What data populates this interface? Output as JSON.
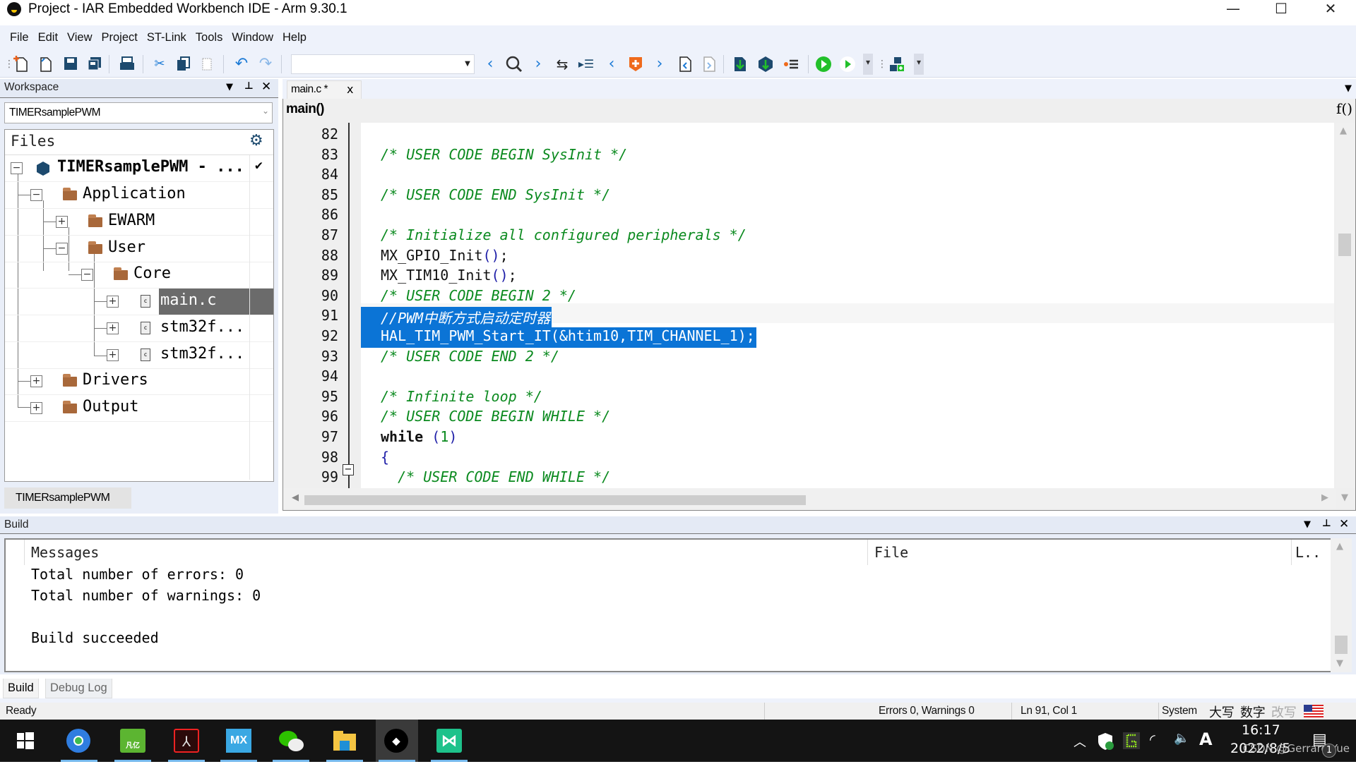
{
  "window": {
    "title": "Project - IAR Embedded Workbench IDE - Arm 9.30.1",
    "controls": {
      "minimize": "—",
      "maximize": "☐",
      "close": "✕"
    }
  },
  "menu": [
    "File",
    "Edit",
    "View",
    "Project",
    "ST-Link",
    "Tools",
    "Window",
    "Help"
  ],
  "toolbar": {
    "icons": [
      "new-file",
      "open-file",
      "save",
      "save-all",
      "print",
      "cut",
      "copy",
      "paste",
      "undo",
      "redo",
      "find-combo",
      "navigate-back",
      "find",
      "navigate-forward",
      "toggle-bookmark",
      "indent",
      "previous-bookmark",
      "toggle-breakpoint",
      "next-bookmark",
      "previous-error",
      "next-error",
      "download-debug",
      "debug-without-download",
      "stop-build",
      "make-run",
      "run-without-debug",
      "configure"
    ],
    "search_value": ""
  },
  "workspace": {
    "title": "Workspace",
    "config": "TIMERsamplePWM",
    "files_header": "Files",
    "tree": [
      {
        "label": "TIMERsamplePWM - ...",
        "type": "project",
        "expanded": true,
        "checked": true
      },
      {
        "label": "Application",
        "type": "folder",
        "expanded": true
      },
      {
        "label": "EWARM",
        "type": "folder",
        "expanded": false
      },
      {
        "label": "User",
        "type": "folder",
        "expanded": true
      },
      {
        "label": "Core",
        "type": "folder",
        "expanded": true
      },
      {
        "label": "main.c",
        "type": "file",
        "selected": true
      },
      {
        "label": "stm32f...",
        "type": "file"
      },
      {
        "label": "stm32f...",
        "type": "file"
      },
      {
        "label": "Drivers",
        "type": "folder",
        "expanded": false
      },
      {
        "label": "Output",
        "type": "folder",
        "expanded": false
      }
    ],
    "bottom_tab": "TIMERsamplePWM"
  },
  "editor": {
    "tab": "main.c *",
    "tab_close": "x",
    "function_scope": "main()",
    "function_icon": "f()",
    "lines": [
      {
        "n": "82",
        "text": ""
      },
      {
        "n": "83",
        "text": "/* USER CODE BEGIN SysInit */"
      },
      {
        "n": "84",
        "text": ""
      },
      {
        "n": "85",
        "text": "/* USER CODE END SysInit */"
      },
      {
        "n": "86",
        "text": ""
      },
      {
        "n": "87",
        "text": "/* Initialize all configured peripherals */"
      },
      {
        "n": "88",
        "text": "MX_GPIO_Init();"
      },
      {
        "n": "89",
        "text": "MX_TIM10_Init();"
      },
      {
        "n": "90",
        "text": "/* USER CODE BEGIN 2 */"
      },
      {
        "n": "91",
        "text": "//PWM中断方式启动定时器"
      },
      {
        "n": "92",
        "text": "HAL_TIM_PWM_Start_IT(&htim10,TIM_CHANNEL_1);"
      },
      {
        "n": "93",
        "text": "/* USER CODE END 2 */"
      },
      {
        "n": "94",
        "text": ""
      },
      {
        "n": "95",
        "text": "/* Infinite loop */"
      },
      {
        "n": "96",
        "text": "/* USER CODE BEGIN WHILE */"
      },
      {
        "n": "97",
        "text": "while (1)"
      },
      {
        "n": "98",
        "text": "{"
      },
      {
        "n": "99",
        "text": "  /* USER CODE END WHILE */"
      }
    ],
    "selected_lines": [
      "91",
      "92"
    ],
    "fold_marker_line": "98"
  },
  "build": {
    "title": "Build",
    "columns": [
      "Messages",
      "File",
      "L.."
    ],
    "messages": [
      "Total number of errors: 0",
      "Total number of warnings: 0",
      "",
      "Build succeeded"
    ],
    "tabs": [
      "Build",
      "Debug Log"
    ],
    "active_tab": "Build"
  },
  "status": {
    "ready": "Ready",
    "errors": "Errors 0, Warnings 0",
    "position": "Ln 91, Col 1",
    "encoding": "System",
    "caps": "大写",
    "num": "数字",
    "ovr": "改写"
  },
  "taskbar": {
    "apps": [
      "Start",
      "Chrome",
      "凡亿教育",
      "Adobe Acrobat",
      "STM32CubeMX",
      "WeChat",
      "File Explorer",
      "IAR Embedded Workbench",
      "STM32CubeMX Launcher"
    ],
    "time": "16:17",
    "date": "2022/8/5",
    "ime": "A",
    "notifications": "1",
    "watermark": "CSDN @Gerrard Yue"
  },
  "colors": {
    "selection": "#0b74d6",
    "comment": "#0b8a1f",
    "paren": "#1f1fa8",
    "chrome": "#eef2fb"
  }
}
